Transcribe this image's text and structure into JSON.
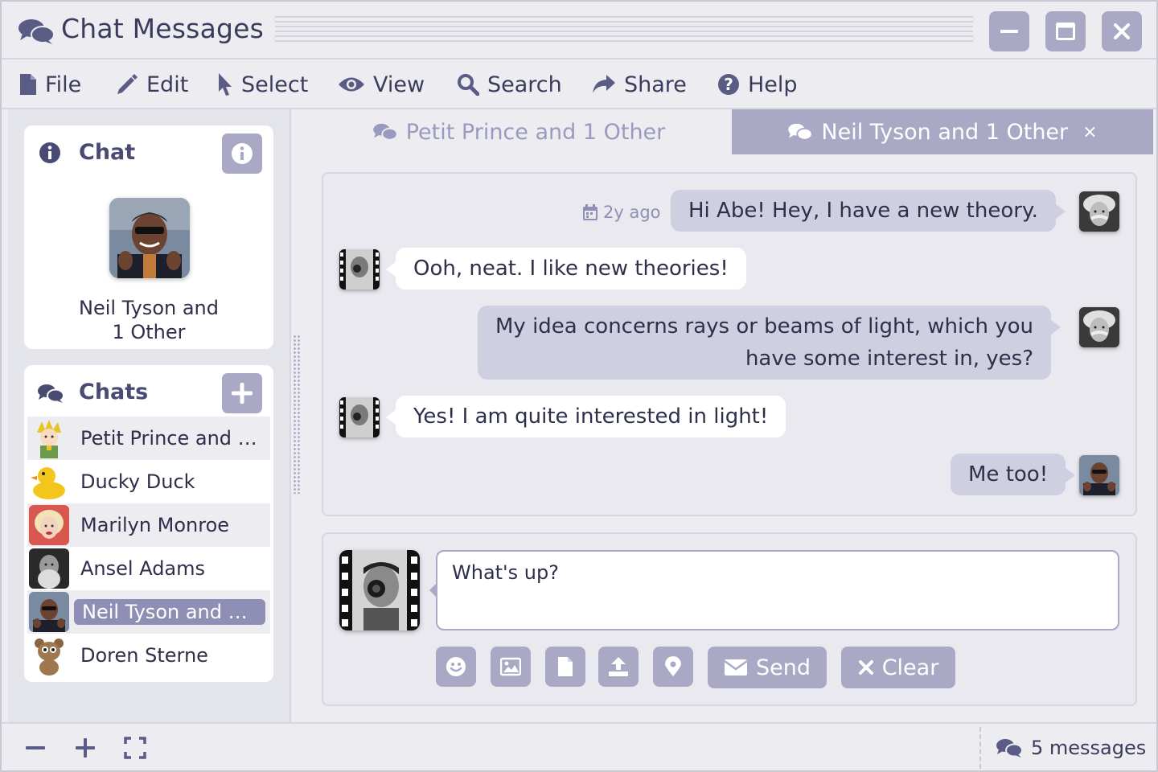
{
  "window": {
    "title": "Chat Messages",
    "controls": [
      "minimize-icon",
      "maximize-icon",
      "close-icon"
    ]
  },
  "menu": [
    {
      "label": "File",
      "icon": "file-icon"
    },
    {
      "label": "Edit",
      "icon": "pencil-icon"
    },
    {
      "label": "Select",
      "icon": "cursor-icon"
    },
    {
      "label": "View",
      "icon": "eye-icon"
    },
    {
      "label": "Search",
      "icon": "search-icon"
    },
    {
      "label": "Share",
      "icon": "share-icon"
    },
    {
      "label": "Help",
      "icon": "help-icon"
    }
  ],
  "chat_info": {
    "title": "Chat",
    "name_line1": "Neil Tyson and",
    "name_line2": "1 Other"
  },
  "chats": {
    "title": "Chats",
    "items": [
      {
        "name": "Petit Prince and 1 Other",
        "display": "Petit Prince and 1...",
        "selected": false
      },
      {
        "name": "Ducky Duck",
        "display": "Ducky Duck",
        "selected": false
      },
      {
        "name": "Marilyn Monroe",
        "display": "Marilyn Monroe",
        "selected": false
      },
      {
        "name": "Ansel Adams",
        "display": "Ansel Adams",
        "selected": false
      },
      {
        "name": "Neil Tyson and 1 Other",
        "display": "Neil Tyson and 1 ...",
        "selected": true
      },
      {
        "name": "Doren Sterne",
        "display": "Doren Sterne",
        "selected": false
      }
    ]
  },
  "tabs": [
    {
      "label": "Petit Prince and 1 Other",
      "active": false
    },
    {
      "label": "Neil Tyson and 1 Other",
      "active": true,
      "close": "×"
    }
  ],
  "messages": [
    {
      "direction": "out",
      "text": "Hi Abe!   Hey, I have a new theory.",
      "timestamp": "2y ago"
    },
    {
      "direction": "in",
      "text": "Ooh, neat.   I like new theories!"
    },
    {
      "direction": "out",
      "line1": "My idea concerns rays or beams of light, which you",
      "line2": "have some interest in, yes?"
    },
    {
      "direction": "in",
      "text": "Yes!  I am quite interested in light!"
    },
    {
      "direction": "out",
      "text": "Me too!"
    }
  ],
  "compose": {
    "value": "What's up?",
    "send_label": "Send",
    "clear_label": "Clear",
    "tools": [
      "emoji-icon",
      "image-icon",
      "file-icon",
      "upload-icon",
      "location-icon"
    ]
  },
  "status": {
    "count_label": "5 messages"
  },
  "colors": {
    "accent": "#a9a9c6",
    "accent_dark": "#8f8fb6",
    "outgoing_bubble": "#cfcfe2",
    "incoming_bubble": "#ffffff",
    "text": "#2e2f4a"
  }
}
